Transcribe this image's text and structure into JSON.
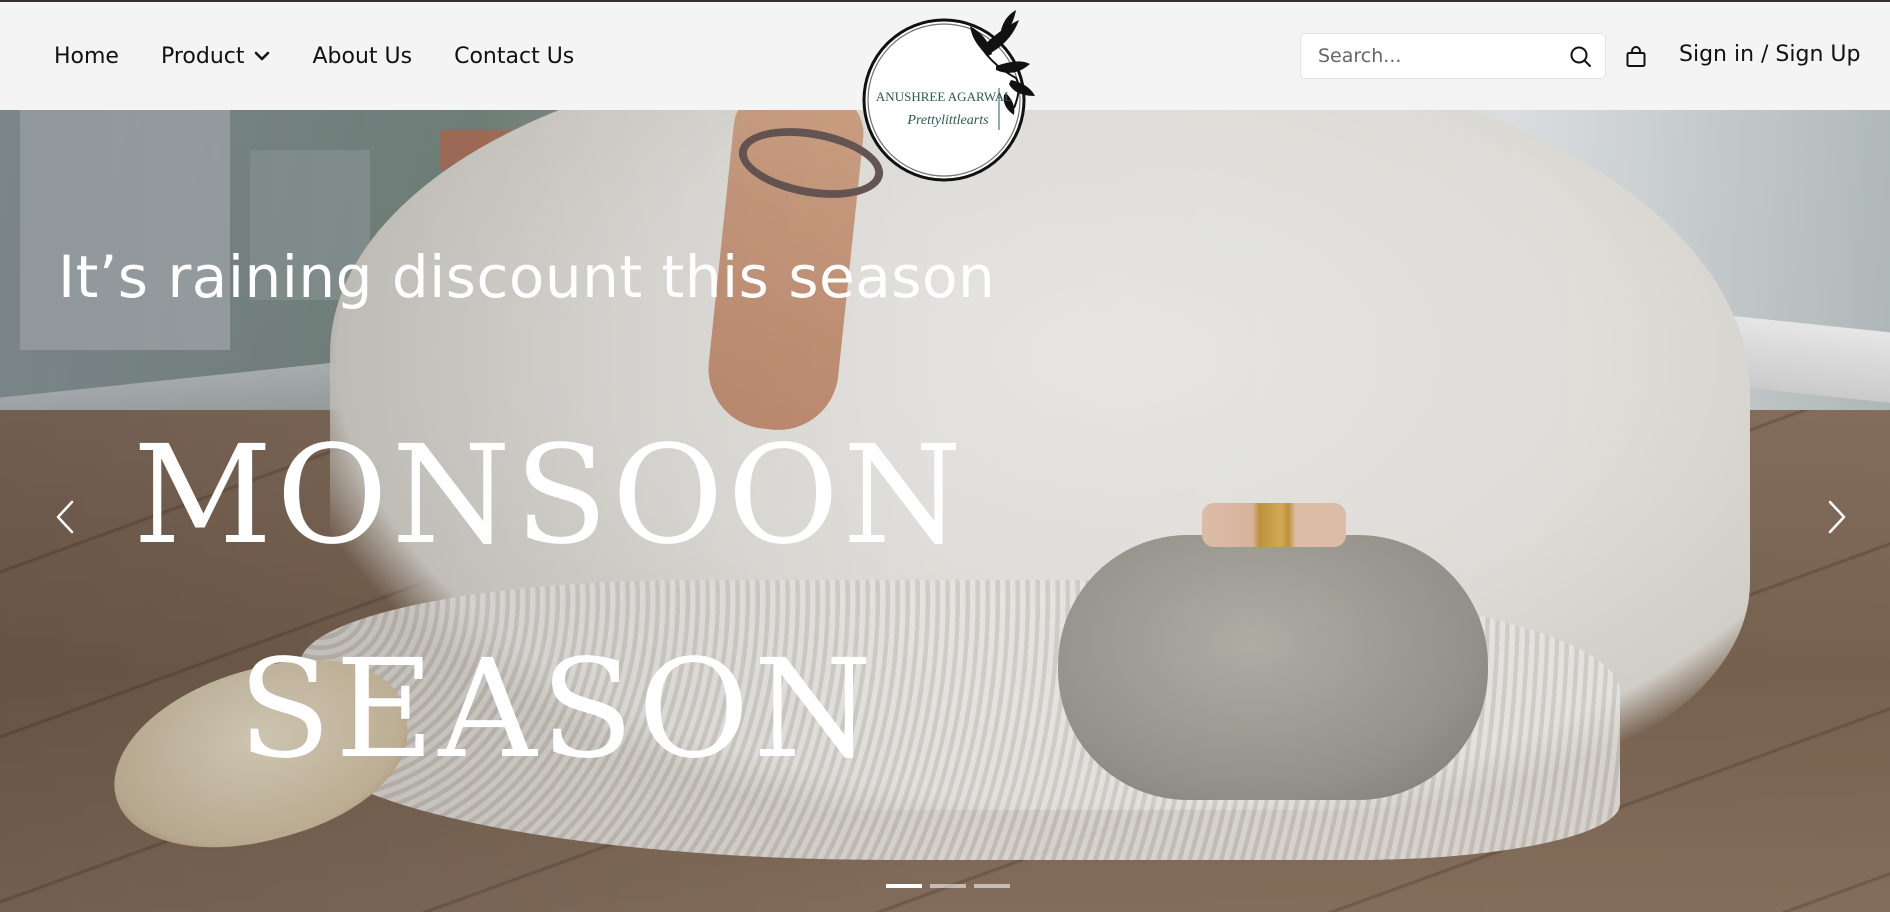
{
  "nav": {
    "items": [
      {
        "label": "Home"
      },
      {
        "label": "Product"
      },
      {
        "label": "About Us"
      },
      {
        "label": "Contact Us"
      }
    ]
  },
  "logo": {
    "line1": "ANUSHREE AGARWAL",
    "line2": "Prettylittlearts"
  },
  "search": {
    "placeholder": "Search...",
    "value": ""
  },
  "account": {
    "signin_label": "Sign in / Sign Up"
  },
  "hero": {
    "subtitle": "It’s raining discount this season",
    "title_line1": "MONSOON",
    "title_line2": "SEASON",
    "slides_count": 3,
    "active_slide": 1
  },
  "icons": {
    "search": "search-icon",
    "bag": "shopping-bag-icon",
    "chevron": "chevron-down-icon",
    "prev": "chevron-left-icon",
    "next": "chevron-right-icon"
  }
}
